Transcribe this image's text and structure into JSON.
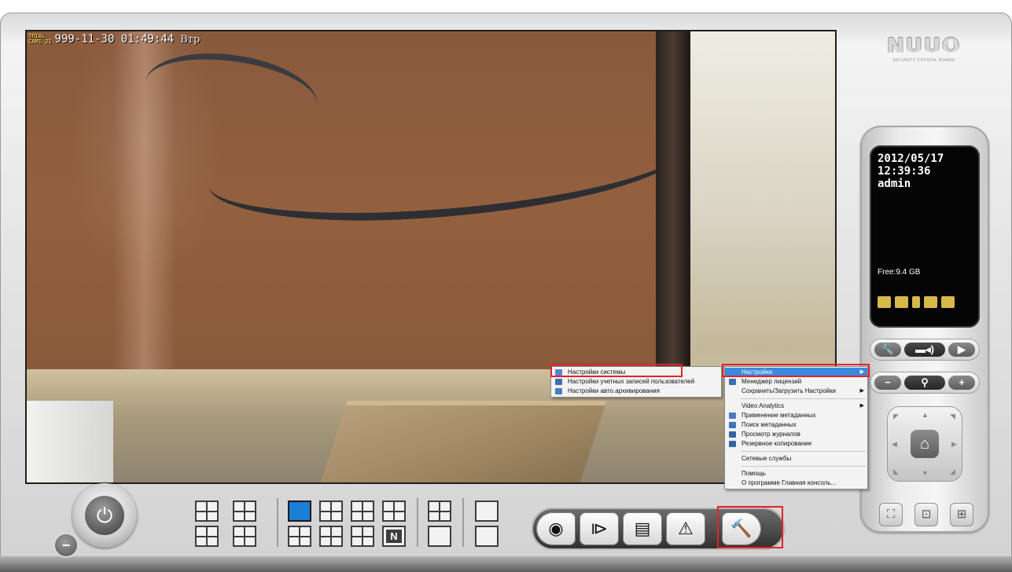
{
  "osd": {
    "trial_tag": "TRIAL",
    "cam_tag": "CAM1 21",
    "timestamp": "999-11-30 01:49:44",
    "day": "Втр"
  },
  "logo": {
    "text": "NUUO",
    "sub": "SECURITY CRYSTAL BOARD"
  },
  "status": {
    "date": "2012/05/17",
    "time": "12:39:36",
    "user": "admin",
    "free": "Free:9.4 GB",
    "icons": [
      "monitor-icon",
      "playback-icon",
      "phone-icon",
      "network-icon",
      "keyboard-icon"
    ]
  },
  "ptz": {
    "zoom_out": "−",
    "zoom_in": "+",
    "home": "⌂"
  },
  "layouts": [
    "1+5",
    "2x2",
    "1+3",
    "3x3",
    "1+7",
    "4x4",
    "1x1",
    "3x3",
    "1+12",
    "4x4",
    "5x5",
    "N",
    "full-grid",
    "full-screen",
    "rotate",
    "exit-full"
  ],
  "toolbar": {
    "items": [
      "schedule",
      "playback",
      "event-log",
      "alarm",
      "settings"
    ]
  },
  "menu_main": {
    "items": [
      {
        "label": "Настройки",
        "submenu": true,
        "selected": true
      },
      {
        "label": "Менеджер лицензий"
      },
      {
        "label": "Сохранить/Загрузить Настройки",
        "submenu": true
      },
      {
        "separator": true
      },
      {
        "label": "Video Analytics",
        "submenu": true
      },
      {
        "label": "Применение метаданных"
      },
      {
        "label": "Поиск метаданных"
      },
      {
        "label": "Просмотр журналов"
      },
      {
        "label": "Резервное копирование"
      },
      {
        "separator": true
      },
      {
        "label": "Сетевые службы"
      },
      {
        "separator": true
      },
      {
        "label": "Помощь"
      },
      {
        "label": "О программе Главная консоль..."
      }
    ]
  },
  "menu_sub": {
    "items": [
      {
        "label": "Настройки системы"
      },
      {
        "label": "Настройки учетных записей пользователей"
      },
      {
        "label": "Настройки авто.архивирования"
      }
    ]
  },
  "colors": {
    "highlight": "#e3232a",
    "menu_selection": "#3a8ae0",
    "active_layout": "#1b7ed7"
  }
}
